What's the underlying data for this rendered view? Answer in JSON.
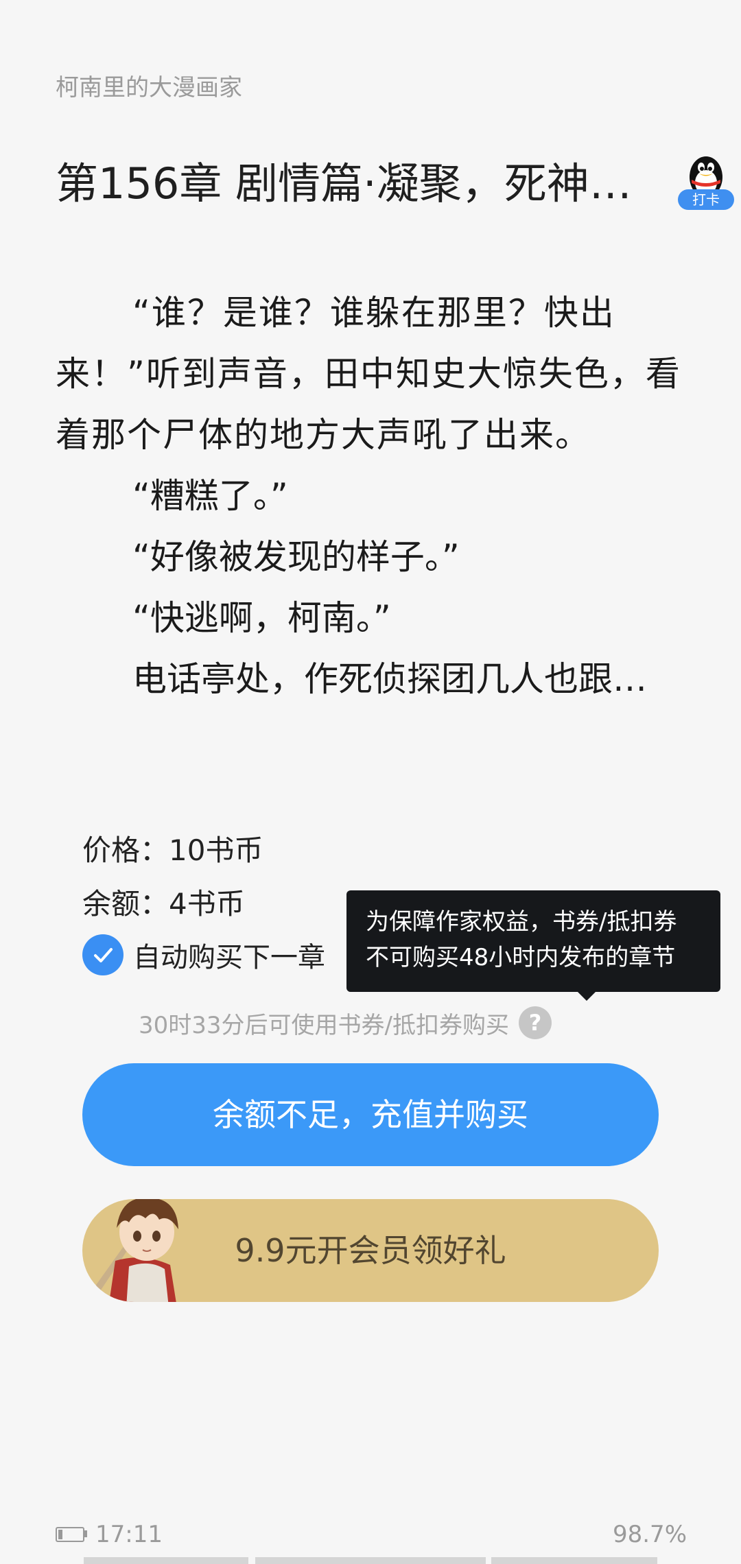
{
  "header": {
    "book_name": "柯南里的大漫画家",
    "chapter_title": "第156章 剧情篇·凝聚，死神…",
    "checkin_label": "打卡"
  },
  "content": {
    "paragraphs": [
      "“谁？是谁？谁躲在那里？快出来！”听到声音，田中知史大惊失色，看着那个尸体的地方大声吼了出来。",
      "“糟糕了。”",
      "“好像被发现的样子。”",
      "“快逃啊，柯南。”",
      "电话亭处，作死侦探团几人也跟…"
    ]
  },
  "purchase": {
    "price_text": "价格：10书币",
    "balance_text": "余额：4书币",
    "auto_buy_label": "自动购买下一章",
    "auto_buy_checked": true,
    "tooltip_line1": "为保障作家权益，书券/抵扣券",
    "tooltip_line2": "不可购买48小时内发布的章节",
    "coupon_note": "30时33分后可使用书券/抵扣券购买",
    "help_symbol": "?",
    "recharge_button": "余额不足，充值并购买",
    "vip_banner": "9.9元开会员领好礼"
  },
  "status": {
    "time": "17:11",
    "progress": "98.7%"
  },
  "colors": {
    "accent_blue": "#3b99f8",
    "vip_gold": "#dfc586",
    "tooltip_bg": "#16181b",
    "page_bg": "#f6f6f6"
  },
  "icons": {
    "checkin": "qq-penguin-icon",
    "auto_buy": "checkmark-icon",
    "help": "question-icon",
    "battery": "battery-icon",
    "mascot": "anime-character-illustration"
  }
}
